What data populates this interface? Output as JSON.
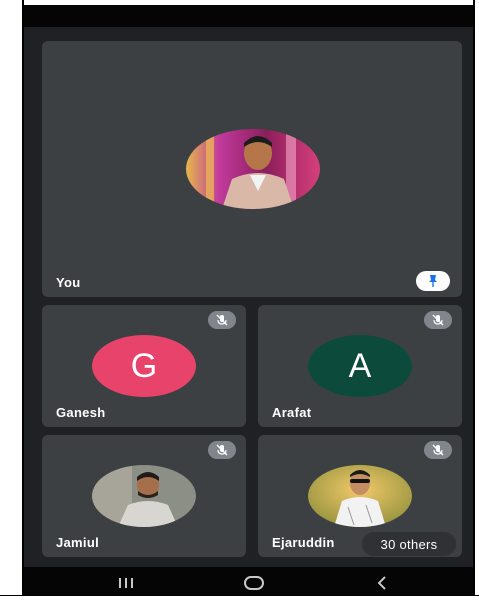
{
  "participants": {
    "you": {
      "name": "You",
      "avatar_type": "photo",
      "pinned": true
    },
    "tiles": [
      {
        "name": "Ganesh",
        "avatar_letter": "G",
        "avatar_color": "#e8436a",
        "muted": true
      },
      {
        "name": "Arafat",
        "avatar_letter": "A",
        "avatar_color": "#0c4b3b",
        "muted": true
      },
      {
        "name": "Jamiul",
        "avatar_type": "photo",
        "muted": true
      },
      {
        "name": "Ejaruddin",
        "avatar_type": "photo",
        "muted": true
      }
    ]
  },
  "others": {
    "label": "30 others"
  },
  "icons": {
    "pin": "pin-icon",
    "mute": "mic-off-icon",
    "nav_recents": "recents-icon",
    "nav_home": "home-icon",
    "nav_back": "back-icon"
  },
  "colors": {
    "background": "#202124",
    "tile": "#3c4043",
    "accent_blue": "#1a73e8"
  }
}
